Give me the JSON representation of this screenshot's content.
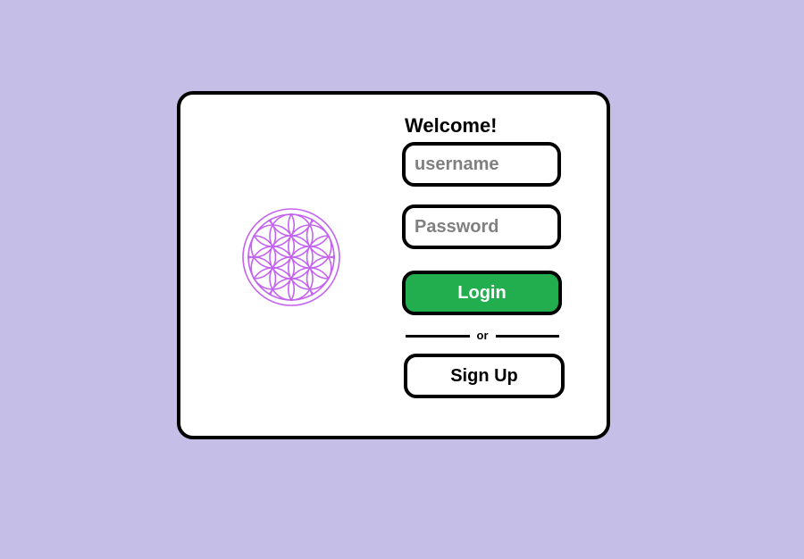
{
  "background_color": "#c5bee6",
  "accent_color": "#22ae4f",
  "logo": {
    "icon": "flower-of-life-icon",
    "color": "#c463f0"
  },
  "login_form": {
    "title": "Welcome!",
    "username_placeholder": "username",
    "password_placeholder": "Password",
    "login_label": "Login",
    "divider_text": "or",
    "signup_label": "Sign Up"
  }
}
